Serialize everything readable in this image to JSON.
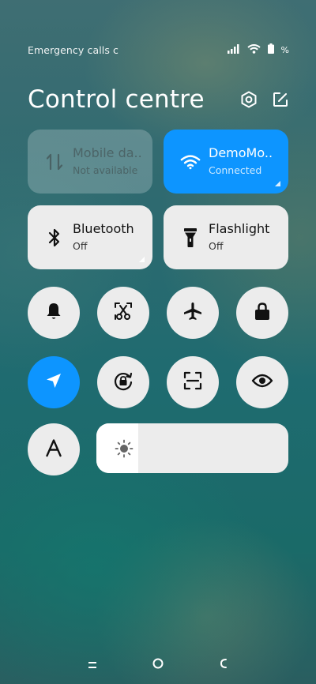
{
  "status_bar": {
    "left_text": "Emergency calls c",
    "battery_text": "%",
    "icons": [
      "signal-icon",
      "wifi-icon",
      "battery-icon"
    ]
  },
  "header": {
    "title": "Control centre",
    "icons": [
      "settings-icon",
      "edit-icon"
    ]
  },
  "tiles": {
    "mobile_data": {
      "label": "Mobile da..",
      "status": "Not available",
      "icon": "mobile-data-icon"
    },
    "wifi": {
      "label": "DemoMo..",
      "status": "Connected",
      "icon": "wifi-icon"
    },
    "bluetooth": {
      "label": "Bluetooth",
      "status": "Off",
      "icon": "bluetooth-icon"
    },
    "flashlight": {
      "label": "Flashlight",
      "status": "Off",
      "icon": "flashlight-icon"
    }
  },
  "toggles": [
    {
      "name": "bell-icon",
      "active": false
    },
    {
      "name": "screenshot-icon",
      "active": false
    },
    {
      "name": "airplane-icon",
      "active": false
    },
    {
      "name": "lock-icon",
      "active": false
    },
    {
      "name": "location-icon",
      "active": true
    },
    {
      "name": "rotation-lock-icon",
      "active": false
    },
    {
      "name": "scan-icon",
      "active": false
    },
    {
      "name": "eye-icon",
      "active": false
    },
    {
      "name": "font-size-icon",
      "active": false
    }
  ],
  "brightness": {
    "level": 0.22,
    "icon": "sun-icon"
  },
  "colors": {
    "accent": "#0d95ff",
    "tile": "#ececec"
  },
  "navbar": {
    "buttons": [
      "recent-apps-icon",
      "home-icon",
      "back-icon"
    ]
  }
}
